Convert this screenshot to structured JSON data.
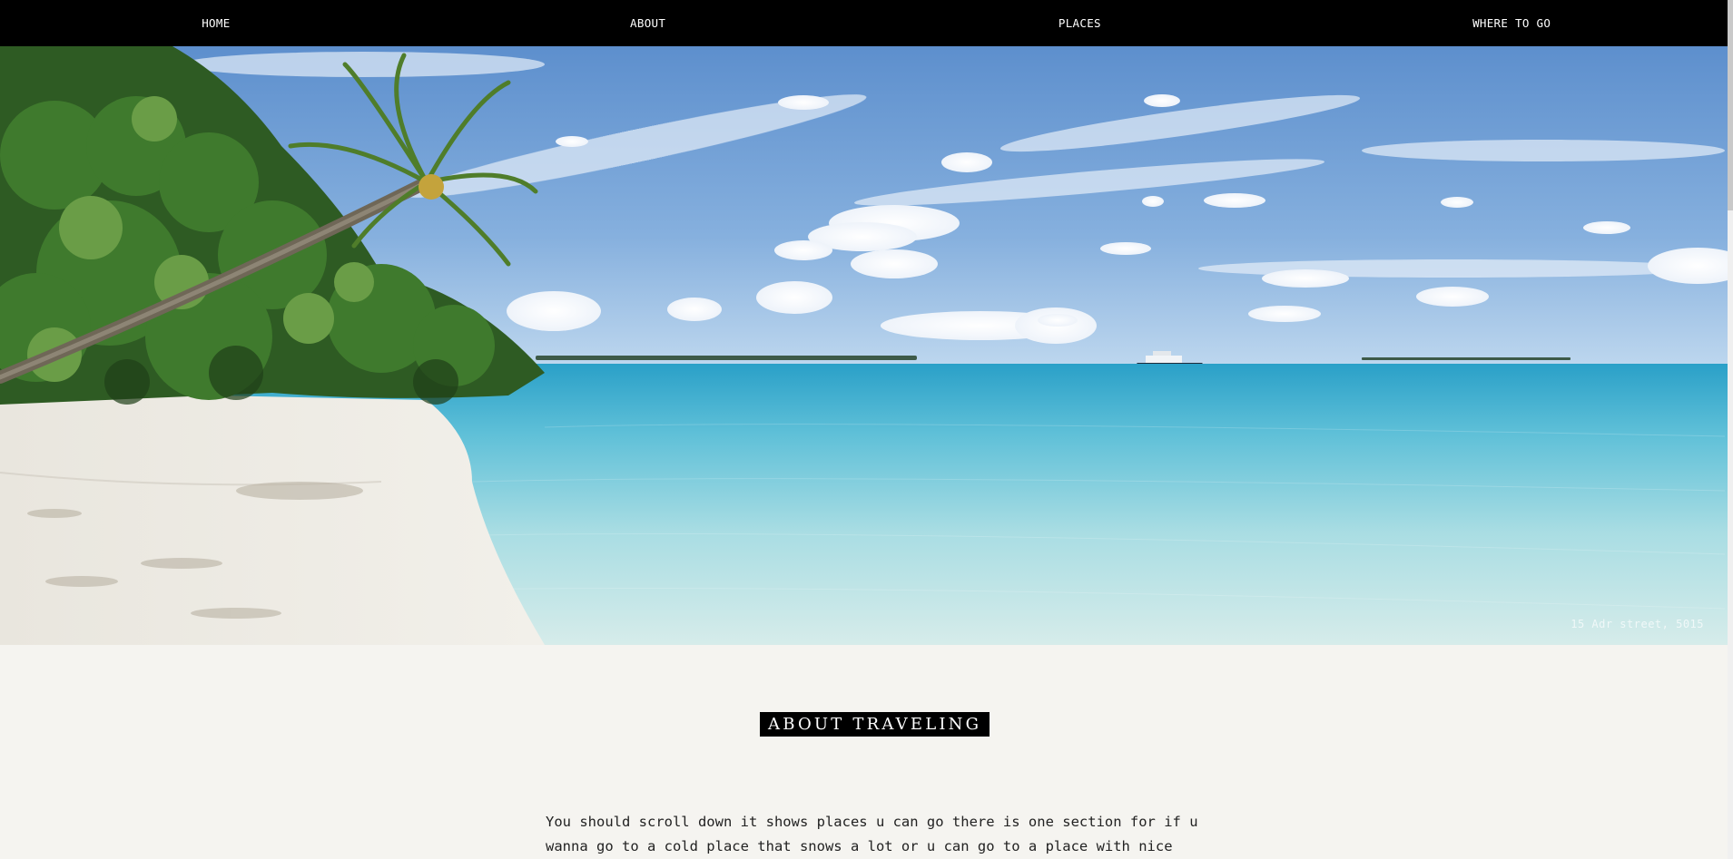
{
  "nav": {
    "items": [
      {
        "label": "HOME"
      },
      {
        "label": "ABOUT"
      },
      {
        "label": "PLACES"
      },
      {
        "label": "WHERE TO GO"
      }
    ]
  },
  "hero": {
    "address": "15 Adr street, 5015"
  },
  "about": {
    "title": "ABOUT TRAVELING",
    "text": "You should scroll down it shows places u can go there is one section for if u wanna go to a cold place that snows a lot or u can go to a place with nice"
  },
  "colors": {
    "nav_bg": "#000000",
    "page_bg": "#f5f4f0",
    "title_bg": "#000000"
  }
}
